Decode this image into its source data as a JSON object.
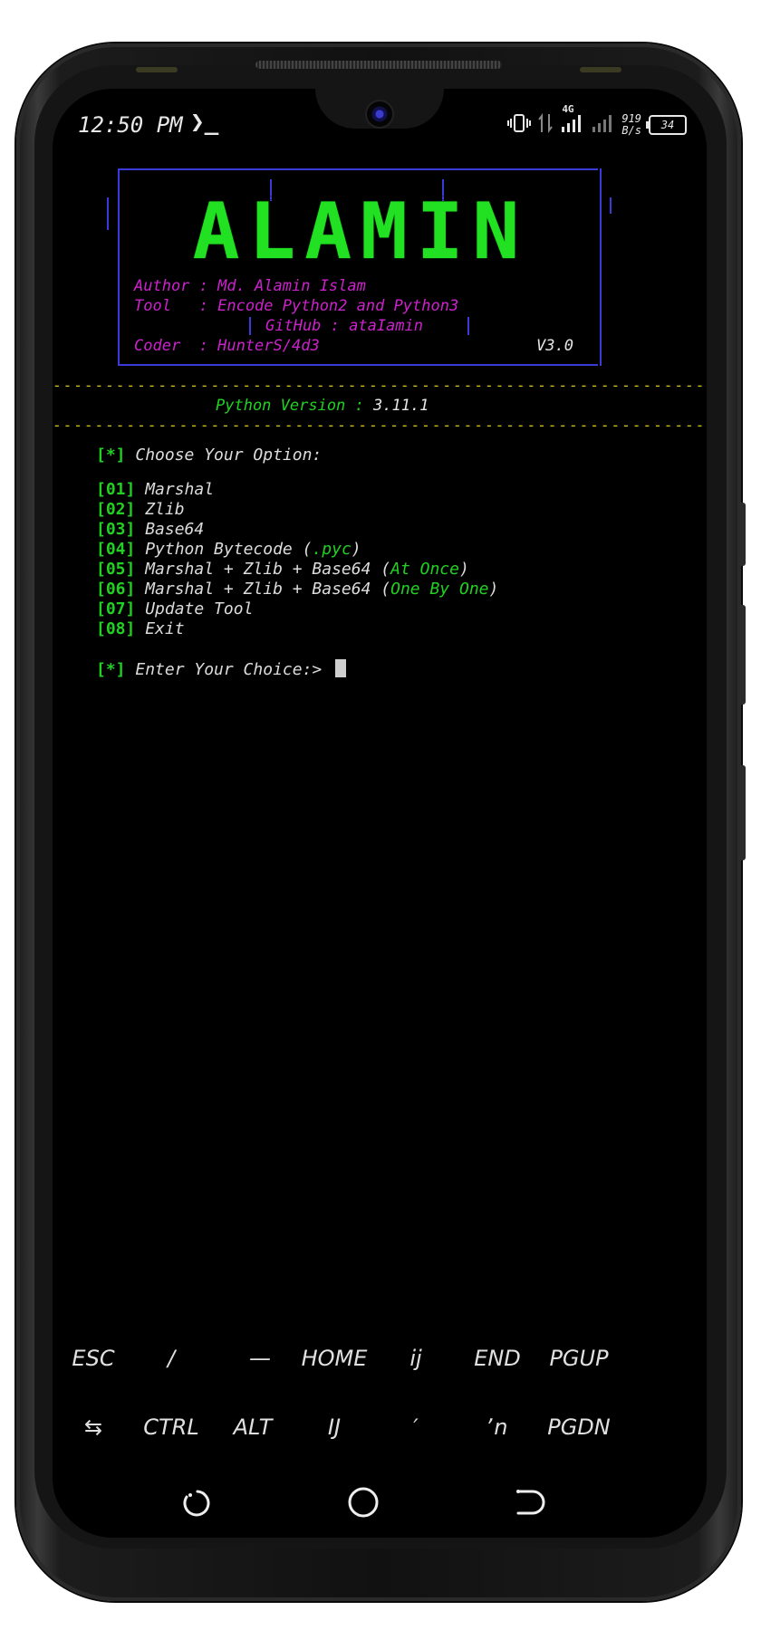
{
  "status_bar": {
    "time": "12:50 PM",
    "prompt_glyph": "❯_",
    "vibrate_icon": "vibrate-icon",
    "data_arrows_icon": "data-transfer-icon",
    "network_type": "4G",
    "net_speed_value": "919",
    "net_speed_unit": "B/s",
    "battery_level": "34"
  },
  "banner": {
    "logo": "ALAMIN",
    "author_line": "Author : Md. Alamin Islam",
    "tool_line": "Tool   : Encode Python2 and Python3",
    "github_line": "GitHub : ataIamin",
    "coder_line": "Coder  : HunterS/4d3",
    "version": "V3.0"
  },
  "python_version_line": "Python Version : ",
  "python_version_value": "3.11.1",
  "menu": {
    "prompt_header_tag": "[*]",
    "prompt_header_text": " Choose Your Option:",
    "items": [
      {
        "num": "[01]",
        "label": " Marshal",
        "extra": "",
        "paren": ""
      },
      {
        "num": "[02]",
        "label": " Zlib",
        "extra": "",
        "paren": ""
      },
      {
        "num": "[03]",
        "label": " Base64",
        "extra": "",
        "paren": ""
      },
      {
        "num": "[04]",
        "label": " Python Bytecode (",
        "extra": ".pyc",
        "paren": ")"
      },
      {
        "num": "[05]",
        "label": " Marshal + Zlib + Base64 (",
        "extra": "At Once",
        "paren": ")"
      },
      {
        "num": "[06]",
        "label": " Marshal + Zlib + Base64 (",
        "extra": "One By One",
        "paren": ")"
      },
      {
        "num": "[07]",
        "label": " Update Tool",
        "extra": "",
        "paren": ""
      },
      {
        "num": "[08]",
        "label": " Exit",
        "extra": "",
        "paren": ""
      }
    ],
    "input_tag": "[*]",
    "input_prompt": " Enter Your Choice:> "
  },
  "extra_keys": {
    "row1": [
      "ESC",
      "/",
      "—",
      "HOME",
      "ij",
      "END",
      "PGUP"
    ],
    "row2": [
      "⇆",
      "CTRL",
      "ALT",
      "IJ",
      "′",
      "ʼn",
      "PGDN"
    ]
  },
  "nav_bar": {
    "back_icon": "back-icon",
    "home_icon": "home-icon",
    "recents_icon": "recents-icon"
  },
  "colors": {
    "logo_green": "#22e022",
    "banner_magenta": "#cc22cc",
    "banner_border": "#3a3ad8",
    "dash_yellow": "#d8c418",
    "bracket_green": "#22d022"
  }
}
